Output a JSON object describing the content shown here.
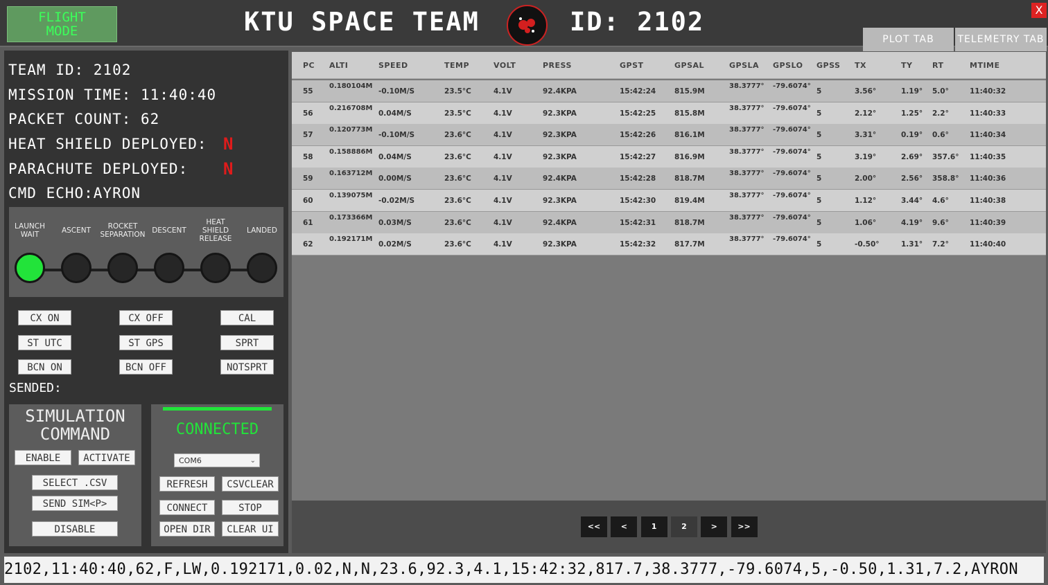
{
  "header": {
    "flight_mode": "FLIGHT\nMODE",
    "title": "KTU SPACE TEAM",
    "id_label": "ID: 2102",
    "close": "X",
    "tabs": [
      "PLOT TAB",
      "TELEMETRY TAB"
    ]
  },
  "status": {
    "team_id": "TEAM ID: 2102",
    "mission_time": "MISSION TIME: 11:40:40",
    "packet_count": "PACKET COUNT: 62",
    "heat_shield_label": "HEAT SHIELD DEPLOYED:",
    "heat_shield_value": "N",
    "parachute_label": "PARACHUTE DEPLOYED:",
    "parachute_value": "N",
    "cmd_echo": "CMD ECHO:AYRON"
  },
  "stages": [
    "LAUNCH WAIT",
    "ASCENT",
    "ROCKET SEPARATION",
    "DESCENT",
    "HEAT SHIELD RELEASE",
    "LANDED"
  ],
  "active_stage": 0,
  "commands": {
    "cx_on": "CX ON",
    "cx_off": "CX OFF",
    "cal": "CAL",
    "st_utc": "ST UTC",
    "st_gps": "ST GPS",
    "sprt": "SPRT",
    "bcn_on": "BCN ON",
    "bcn_off": "BCN OFF",
    "notsprt": "NOTSPRT"
  },
  "sended_label": "SENDED:",
  "simulation": {
    "title": "SIMULATION\nCOMMAND",
    "enable": "ENABLE",
    "activate": "ACTIVATE",
    "select_csv": "SELECT .CSV",
    "send_sim": "SEND SIM<P>",
    "disable": "DISABLE"
  },
  "connection": {
    "status": "CONNECTED",
    "port": "COM6",
    "refresh": "REFRESH",
    "csvclear": "CSVCLEAR",
    "connect": "CONNECT",
    "stop": "STOP",
    "open_dir": "OPEN DIR",
    "clear_ui": "CLEAR UI"
  },
  "table": {
    "columns": [
      "PC",
      "ALTI",
      "SPEED",
      "TEMP",
      "VOLT",
      "PRESS",
      "GPST",
      "GPSAL",
      "GPSLA",
      "GPSLO",
      "GPSS",
      "TX",
      "TY",
      "RT",
      "MTIME"
    ],
    "rows": [
      [
        "55",
        "0.180104M",
        "-0.10M/S",
        "23.5°C",
        "4.1V",
        "92.4KPA",
        "15:42:24",
        "815.9M",
        "38.3777°",
        "-79.6074°",
        "5",
        "3.56°",
        "1.19°",
        "5.0°",
        "11:40:32"
      ],
      [
        "56",
        "0.216708M",
        "0.04M/S",
        "23.5°C",
        "4.1V",
        "92.3KPA",
        "15:42:25",
        "815.8M",
        "38.3777°",
        "-79.6074°",
        "5",
        "2.12°",
        "1.25°",
        "2.2°",
        "11:40:33"
      ],
      [
        "57",
        "0.120773M",
        "-0.10M/S",
        "23.6°C",
        "4.1V",
        "92.3KPA",
        "15:42:26",
        "816.1M",
        "38.3777°",
        "-79.6074°",
        "5",
        "3.31°",
        "0.19°",
        "0.6°",
        "11:40:34"
      ],
      [
        "58",
        "0.158886M",
        "0.04M/S",
        "23.6°C",
        "4.1V",
        "92.3KPA",
        "15:42:27",
        "816.9M",
        "38.3777°",
        "-79.6074°",
        "5",
        "3.19°",
        "2.69°",
        "357.6°",
        "11:40:35"
      ],
      [
        "59",
        "0.163712M",
        "0.00M/S",
        "23.6°C",
        "4.1V",
        "92.4KPA",
        "15:42:28",
        "818.7M",
        "38.3777°",
        "-79.6074°",
        "5",
        "2.00°",
        "2.56°",
        "358.8°",
        "11:40:36"
      ],
      [
        "60",
        "0.139075M",
        "-0.02M/S",
        "23.6°C",
        "4.1V",
        "92.3KPA",
        "15:42:30",
        "819.4M",
        "38.3777°",
        "-79.6074°",
        "5",
        "1.12°",
        "3.44°",
        "4.6°",
        "11:40:38"
      ],
      [
        "61",
        "0.173366M",
        "0.03M/S",
        "23.6°C",
        "4.1V",
        "92.4KPA",
        "15:42:31",
        "818.7M",
        "38.3777°",
        "-79.6074°",
        "5",
        "1.06°",
        "4.19°",
        "9.6°",
        "11:40:39"
      ],
      [
        "62",
        "0.192171M",
        "0.02M/S",
        "23.6°C",
        "4.1V",
        "92.3KPA",
        "15:42:32",
        "817.7M",
        "38.3777°",
        "-79.6074°",
        "5",
        "-0.50°",
        "1.31°",
        "7.2°",
        "11:40:40"
      ]
    ]
  },
  "pager": [
    "<<",
    "<",
    "1",
    "2",
    ">",
    ">>"
  ],
  "pager_current": 3,
  "raw_packet": "2102,11:40:40,62,F,LW,0.192171,0.02,N,N,23.6,92.3,4.1,15:42:32,817.7,38.3777,-79.6074,5,-0.50,1.31,7.2,AYRON"
}
